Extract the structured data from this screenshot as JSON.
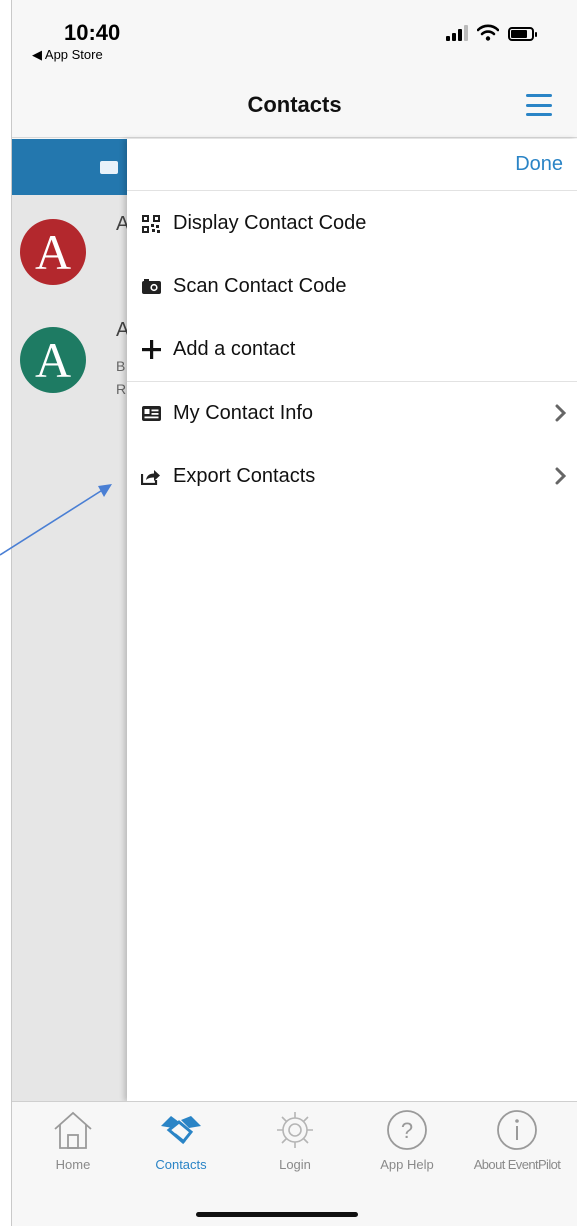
{
  "status_bar": {
    "time": "10:40",
    "back_label": "◀ App Store"
  },
  "nav": {
    "title": "Contacts"
  },
  "underlay": {
    "contacts": [
      {
        "avatar_letter": "A",
        "peek_text": "A"
      },
      {
        "avatar_letter": "A",
        "peek_text": "A",
        "peek_line2": "B",
        "peek_line3": "R"
      }
    ]
  },
  "drawer": {
    "done_label": "Done",
    "menu_items": [
      {
        "label": "Display Contact Code",
        "icon": "qr-code-icon",
        "chevron": false
      },
      {
        "label": "Scan Contact Code",
        "icon": "camera-icon",
        "chevron": false
      },
      {
        "label": "Add a contact",
        "icon": "plus-icon",
        "chevron": false
      },
      {
        "label": "My Contact Info",
        "icon": "id-card-icon",
        "chevron": true
      },
      {
        "label": "Export Contacts",
        "icon": "share-export-icon",
        "chevron": true
      }
    ]
  },
  "tab_bar": {
    "tabs": [
      {
        "label": "Home",
        "icon": "house-icon",
        "active": false
      },
      {
        "label": "Contacts",
        "icon": "handshake-icon",
        "active": true
      },
      {
        "label": "Login",
        "icon": "gear-icon",
        "active": false
      },
      {
        "label": "App Help",
        "icon": "question-circle-icon",
        "active": false
      },
      {
        "label": "About EventPilot",
        "icon": "info-circle-icon",
        "active": false
      }
    ]
  },
  "colors": {
    "accent": "#2a84c6",
    "band": "#2377ae",
    "avatar_red": "#b3282d",
    "avatar_green": "#1e7b63",
    "annotation_arrow": "#4a7fd4"
  }
}
